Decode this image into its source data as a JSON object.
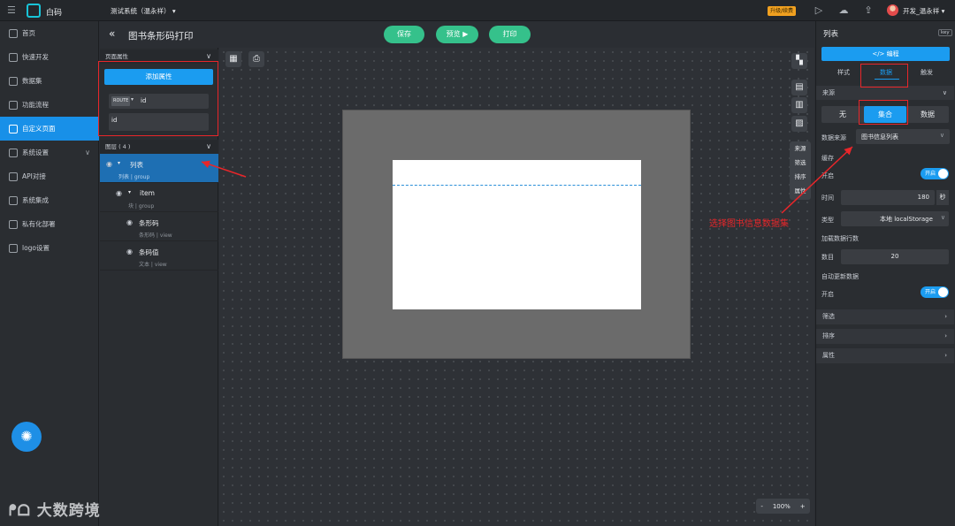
{
  "topbar": {
    "menu_icon": "menu-icon",
    "brand": "白码",
    "project": "测试系统（温永祥）",
    "badge": "升级/续费",
    "user": "开发_温永祥"
  },
  "leftnav": {
    "items": [
      {
        "label": "首页"
      },
      {
        "label": "快速开发"
      },
      {
        "label": "数据集"
      },
      {
        "label": "功能流程"
      },
      {
        "label": "自定义页面"
      },
      {
        "label": "系统设置"
      },
      {
        "label": "API对接"
      },
      {
        "label": "系统集成"
      },
      {
        "label": "私有化部署"
      },
      {
        "label": "logo设置"
      }
    ],
    "active_index": 4,
    "watermark": "大数跨境"
  },
  "page": {
    "back_glyph": "«",
    "title": "图书条形码打印",
    "save": "保存",
    "preview": "预览",
    "print": "打印"
  },
  "props": {
    "section_title": "页面属性",
    "add_button": "添加属性",
    "route_tag": "ROUTE",
    "route_value": "id",
    "param_value": "id",
    "layers_title": "图层 ( 4 )",
    "layers": [
      {
        "name": "列表",
        "type": "列表",
        "kind": "group"
      },
      {
        "name": "item",
        "type": "块",
        "kind": "group"
      },
      {
        "name": "条形码",
        "type": "条形码",
        "kind": "view"
      },
      {
        "name": "条码值",
        "type": "文本",
        "kind": "view"
      }
    ]
  },
  "canvas": {
    "side_tools": [
      "来源",
      "筛选",
      "排序",
      "属性"
    ],
    "zoom": "100%",
    "zoom_minus": "-",
    "zoom_plus": "+"
  },
  "annotation": "选择图书信息数据集",
  "rpanel": {
    "title": "列表",
    "key_badge": "key",
    "code_button": "</> 编程",
    "tabs": [
      "样式",
      "数据",
      "触发"
    ],
    "active_tab": 1,
    "source_section": "来源",
    "source_options": [
      "无",
      "集合",
      "数据"
    ],
    "source_active": 1,
    "datasource_label": "数据来源",
    "datasource_value": "图书信息列表",
    "cache_title": "缓存",
    "cache_enable_label": "开启",
    "cache_toggle": "开启",
    "time_label": "时间",
    "time_value": "180",
    "time_unit": "秒",
    "type_label": "类型",
    "type_value": "本地 localStorage",
    "load_rows_title": "加载数据行数",
    "count_label": "数目",
    "count_value": "20",
    "auto_update_title": "自动更新数据",
    "auto_enable_label": "开启",
    "auto_toggle": "开启",
    "sections": [
      "筛选",
      "排序",
      "属性"
    ]
  },
  "colors": {
    "accent": "#1b9cf0",
    "green": "#35c18b",
    "highlight_red": "#e8262a"
  }
}
